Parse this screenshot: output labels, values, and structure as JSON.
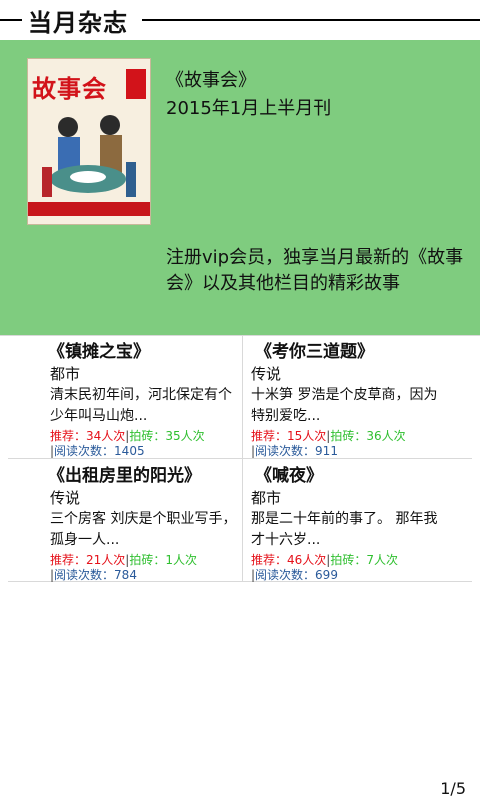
{
  "header": {
    "title": "当月杂志"
  },
  "feature": {
    "cover_name": "故事会",
    "mag_title": "《故事会》",
    "mag_issue": "2015年1月上半月刊",
    "promo": "注册vip会员，独享当月最新的《故事会》以及其他栏目的精彩故事"
  },
  "cards": [
    {
      "title": "《镇摊之宝》",
      "category": "都市",
      "desc": "清末民初年间，河北保定有个少年叫马山炮...",
      "recommend": "推荐：34人次",
      "brick": "拍砖：35人次",
      "views": "阅读次数：1405"
    },
    {
      "title": "《考你三道题》",
      "category": "传说",
      "desc": "十米笋 罗浩是个皮草商，因为特别爱吃...",
      "recommend": "推荐：15人次",
      "brick": "拍砖：36人次",
      "views": "阅读次数：911"
    },
    {
      "title": "《出租房里的阳光》",
      "category": "传说",
      "desc": "三个房客 刘庆是个职业写手，孤身一人...",
      "recommend": "推荐：21人次",
      "brick": "拍砖：1人次",
      "views": "阅读次数：784"
    },
    {
      "title": "《喊夜》",
      "category": "都市",
      "desc": "那是二十年前的事了。 那年我才十六岁...",
      "recommend": "推荐：46人次",
      "brick": "拍砖：7人次",
      "views": "阅读次数：699"
    }
  ],
  "pager": "1/5",
  "colors": {
    "feature_bg": "#7fcc7f",
    "recommend": "#e5111a",
    "brick": "#2fbf2f",
    "views": "#2a5a9a"
  }
}
